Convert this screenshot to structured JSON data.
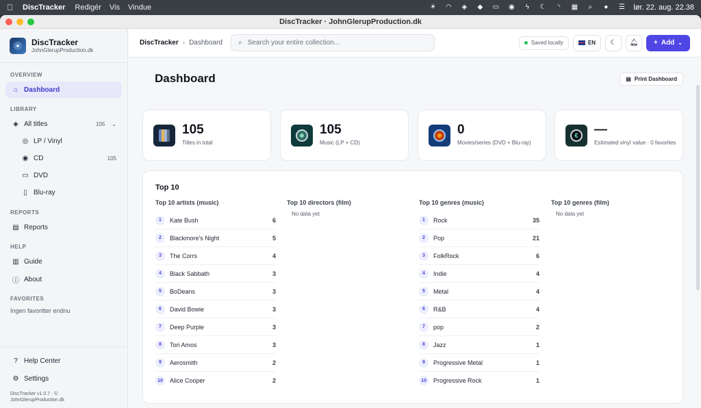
{
  "menubar": {
    "app": "DiscTracker",
    "items": [
      "Redigér",
      "Vis",
      "Vindue"
    ],
    "clock": "lør. 22. aug.  22.38"
  },
  "window": {
    "title": "DiscTracker · JohnGlerupProduction.dk"
  },
  "brand": {
    "name": "DiscTracker",
    "sub": "JohnGlerupProduction.dk"
  },
  "sidebar": {
    "overview_label": "OVERVIEW",
    "dashboard": "Dashboard",
    "library_label": "LIBRARY",
    "all_titles": "All titles",
    "all_titles_count": "105",
    "lp": "LP / Vinyl",
    "cd": "CD",
    "cd_count": "105",
    "dvd": "DVD",
    "bluray": "Blu-ray",
    "reports_label": "REPORTS",
    "reports": "Reports",
    "help_label": "HELP",
    "guide": "Guide",
    "about": "About",
    "favorites_label": "FAVORITES",
    "no_favorites": "Ingen favoritter endnu",
    "help_center": "Help Center",
    "settings": "Settings",
    "version": "DiscTracker v1.0.7 · ©",
    "version_site": "JohnGlerupProduction.dk"
  },
  "header": {
    "crumb_root": "DiscTracker",
    "crumb_current": "Dashboard",
    "search_placeholder": "Search your entire collection...",
    "saved": "Saved locally",
    "lang": "EN",
    "add": "Add"
  },
  "dashboard": {
    "title": "Dashboard",
    "print": "Print Dashboard",
    "stats": [
      {
        "value": "105",
        "label": "Titles in total"
      },
      {
        "value": "105",
        "label": "Music (LP + CD)"
      },
      {
        "value": "0",
        "label": "Movies/series (DVD + Blu-ray)"
      },
      {
        "value": "—",
        "label": "Estimated vinyl value · 0 favorites"
      }
    ],
    "top10_title": "Top 10",
    "artists_title": "Top 10 artists (music)",
    "directors_title": "Top 10 directors (film)",
    "genres_music_title": "Top 10 genres (music)",
    "genres_film_title": "Top 10 genres (film)",
    "no_data": "No data yet",
    "artists": [
      {
        "rank": "1",
        "name": "Kate Bush",
        "count": "6"
      },
      {
        "rank": "2",
        "name": "Blackmore's Night",
        "count": "5"
      },
      {
        "rank": "3",
        "name": "The Corrs",
        "count": "4"
      },
      {
        "rank": "4",
        "name": "Black Sabbath",
        "count": "3"
      },
      {
        "rank": "5",
        "name": "BoDeans",
        "count": "3"
      },
      {
        "rank": "6",
        "name": "David Bowie",
        "count": "3"
      },
      {
        "rank": "7",
        "name": "Deep Purple",
        "count": "3"
      },
      {
        "rank": "8",
        "name": "Tori Amos",
        "count": "3"
      },
      {
        "rank": "9",
        "name": "Aerosmith",
        "count": "2"
      },
      {
        "rank": "10",
        "name": "Alice Cooper",
        "count": "2"
      }
    ],
    "genres": [
      {
        "rank": "1",
        "name": "Rock",
        "count": "35"
      },
      {
        "rank": "2",
        "name": "Pop",
        "count": "21"
      },
      {
        "rank": "3",
        "name": "FolkRock",
        "count": "6"
      },
      {
        "rank": "4",
        "name": "Indie",
        "count": "4"
      },
      {
        "rank": "5",
        "name": "Metal",
        "count": "4"
      },
      {
        "rank": "6",
        "name": "R&B",
        "count": "4"
      },
      {
        "rank": "7",
        "name": "pop",
        "count": "2"
      },
      {
        "rank": "8",
        "name": "Jazz",
        "count": "1"
      },
      {
        "rank": "9",
        "name": "Progressive Metal",
        "count": "1"
      },
      {
        "rank": "10",
        "name": "Progressive Rock",
        "count": "1"
      }
    ]
  },
  "colors": {
    "accent": "#4f46e5",
    "active_bg": "#e7e9fb",
    "saved_dot": "#22c55e"
  }
}
